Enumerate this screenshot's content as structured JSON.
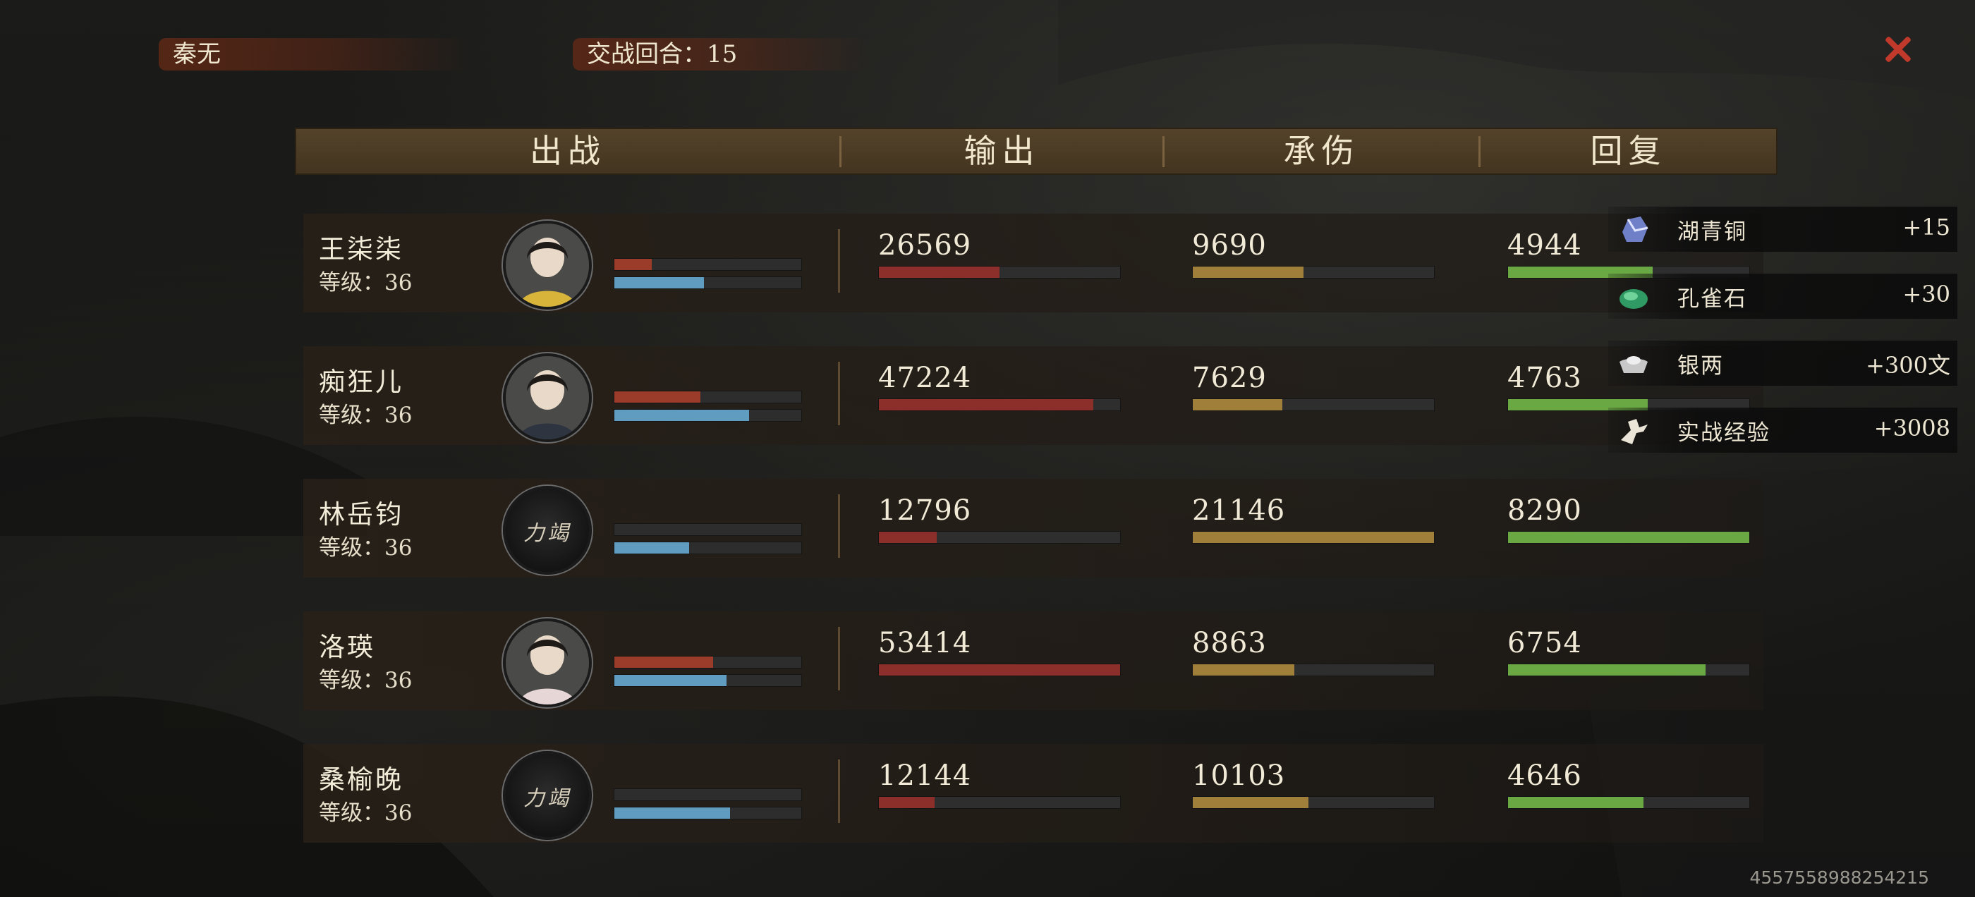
{
  "top": {
    "player_name": "秦无",
    "round_text": "交战回合：15"
  },
  "header": {
    "col_fighter": "出战",
    "col_output": "输出",
    "col_damage_taken": "承伤",
    "col_recovery": "回复"
  },
  "rows": [
    {
      "name": "王柒柒",
      "level": "等级：36",
      "avatar": "portrait",
      "output": "26569",
      "taken": "9690",
      "recovery": "4944",
      "output_fill": 0.5,
      "taken_fill": 0.46,
      "recovery_fill": 0.6,
      "mini_red_fill": 0.2,
      "mini_blue_fill": 0.48
    },
    {
      "name": "痴狂儿",
      "level": "等级：36",
      "avatar": "portrait",
      "output": "47224",
      "taken": "7629",
      "recovery": "4763",
      "output_fill": 0.89,
      "taken_fill": 0.37,
      "recovery_fill": 0.58,
      "mini_red_fill": 0.46,
      "mini_blue_fill": 0.72
    },
    {
      "name": "林岳钧",
      "level": "等级：36",
      "avatar": "locked",
      "avatar_text": "力竭",
      "output": "12796",
      "taken": "21146",
      "recovery": "8290",
      "output_fill": 0.24,
      "taken_fill": 1.0,
      "recovery_fill": 1.0,
      "mini_red_fill": 0.0,
      "mini_blue_fill": 0.4
    },
    {
      "name": "洛瑛",
      "level": "等级：36",
      "avatar": "portrait",
      "output": "53414",
      "taken": "8863",
      "recovery": "6754",
      "output_fill": 1.0,
      "taken_fill": 0.42,
      "recovery_fill": 0.82,
      "mini_red_fill": 0.53,
      "mini_blue_fill": 0.6
    },
    {
      "name": "桑榆晚",
      "level": "等级：36",
      "avatar": "locked",
      "avatar_text": "力竭",
      "output": "12144",
      "taken": "10103",
      "recovery": "4646",
      "output_fill": 0.23,
      "taken_fill": 0.48,
      "recovery_fill": 0.56,
      "mini_red_fill": 0.0,
      "mini_blue_fill": 0.62
    }
  ],
  "rewards": [
    {
      "icon": "bronze-ore-icon",
      "name": "湖青铜",
      "amount": "+15"
    },
    {
      "icon": "malachite-icon",
      "name": "孔雀石",
      "amount": "+30"
    },
    {
      "icon": "silver-ingot-icon",
      "name": "银两",
      "amount": "+300文"
    },
    {
      "icon": "combat-exp-icon",
      "name": "实战经验",
      "amount": "+3008"
    }
  ],
  "footer": {
    "uid": "4557558988254215"
  },
  "colors": {
    "output": "#8c2f2a",
    "taken": "#a07f3a",
    "recovery": "#6aa843",
    "mini_red": "#9b3c2a",
    "mini_blue": "#5f9cc0",
    "close": "#c0392b"
  }
}
